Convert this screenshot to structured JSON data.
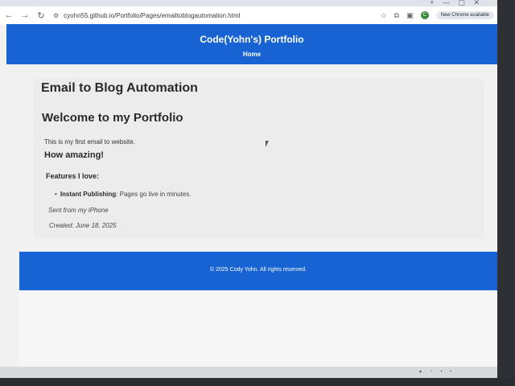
{
  "browser": {
    "url": "cyohn55.github.io/Portfolio/Pages/emailtoblogautomation.html",
    "chrome_button": "New Chrome available",
    "profile_initial": "C"
  },
  "site": {
    "title": "Code(Yohn's) Portfolio",
    "nav_home": "Home"
  },
  "article": {
    "page_heading": "Email to Blog Automation",
    "welcome_heading": "Welcome to my Portfolio",
    "intro": "This is my first email to website.",
    "amazing_heading": "How amazing!",
    "features_heading": "Features I love:",
    "feature_item_title": "Instant Publishing",
    "feature_item_text": ": Pages go live in minutes.",
    "signature": "Sent from my iPhone",
    "created": "Created: June 18, 2025"
  },
  "footer": {
    "copyright": "© 2025 Cody Yohn. All rights reserved."
  },
  "colors": {
    "brand_blue": "#1763d4"
  }
}
